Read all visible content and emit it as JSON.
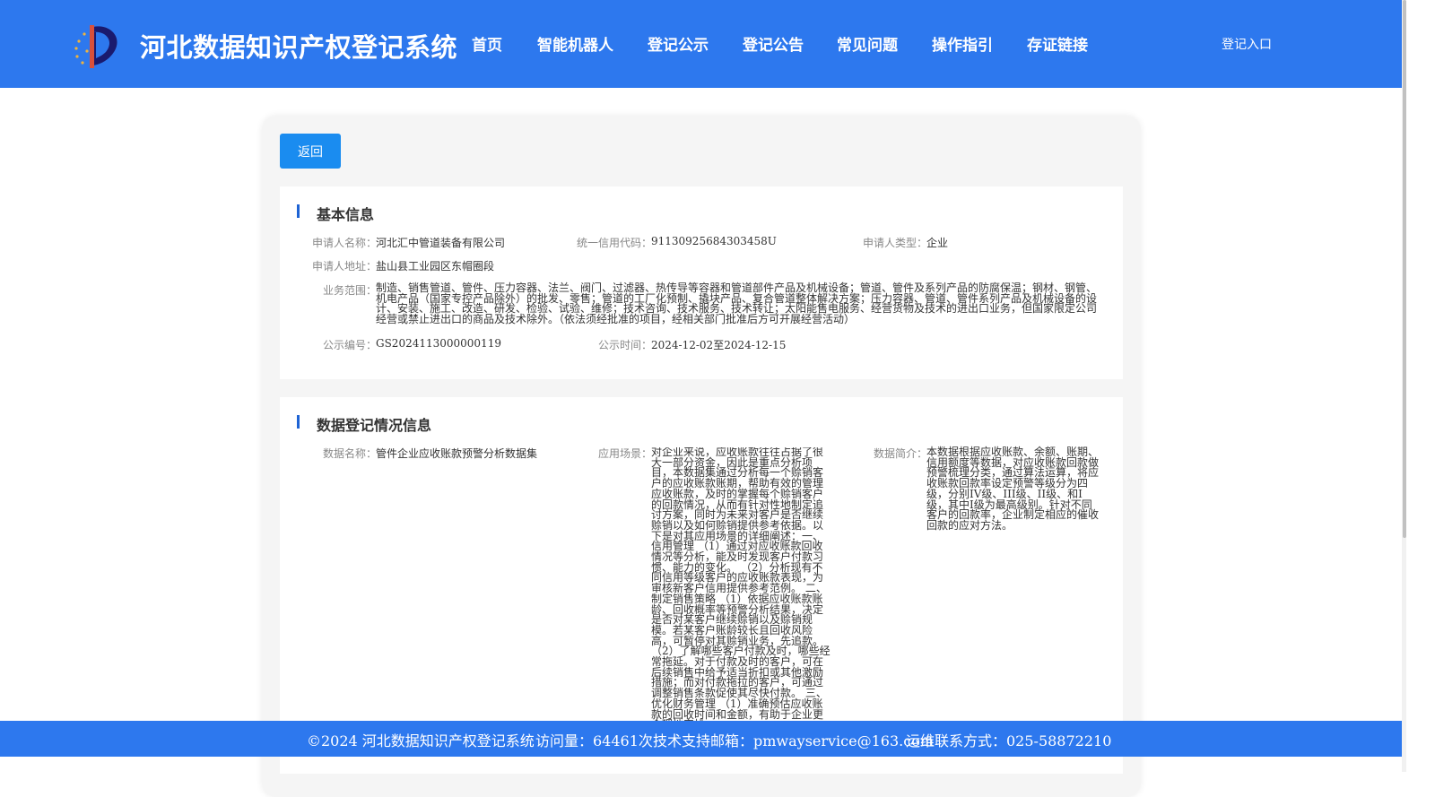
{
  "header": {
    "site_title": "河北数据知识产权登记系统",
    "nav": [
      "首页",
      "智能机器人",
      "登记公示",
      "登记公告",
      "常见问题",
      "操作指引",
      "存证链接"
    ],
    "login": "登记入口"
  },
  "back_button": "返回",
  "basic_info": {
    "title": "基本信息",
    "applicant_name_label": "申请人名称：",
    "applicant_name": "河北汇中管道装备有限公司",
    "credit_code_label": "统一信用代码：",
    "credit_code": "91130925684303458U",
    "applicant_type_label": "申请人类型：",
    "applicant_type": "企业",
    "address_label": "申请人地址：",
    "address": "盐山县工业园区东帽圈段",
    "business_scope_label": "业务范围：",
    "business_scope": "制造、销售管道、管件、压力容器、法兰、阀门、过滤器、热传导等容器和管道部件产品及机械设备；管道、管件及系列产品的防腐保温；钢材、钢管、机电产品（国家专控产品除外）的批发、零售；管道的工厂化预制、撬块产品、复合管道整体解决方案；压力容器、管道、管件系列产品及机械设备的设计、安装、施工、改造、研发、检验、试验、维修；技术咨询、技术服务、技术转让；太阳能售电服务、经营货物及技术的进出口业务，但国家限定公司经营或禁止进出口的商品及技术除外。（依法须经批准的项目，经相关部门批准后方可开展经营活动）",
    "notice_no_label": "公示编号：",
    "notice_no": "GS2024113000000119",
    "notice_time_label": "公示时间：",
    "notice_time": "2024-12-02至2024-12-15"
  },
  "data_info": {
    "title": "数据登记情况信息",
    "data_name_label": "数据名称：",
    "data_name": "管件企业应收账款预警分析数据集",
    "scenario_label": "应用场景：",
    "scenario": "对企业来说，应收账款往往占据了很大一部分资金，因此是重点分析项目，本数据集通过分析每一个赊销客户的应收账款账期，帮助有效的管理应收账款，及时的掌握每个赊销客户的回款情况，从而有针对性地制定追讨方案，同时为未来对客户是否继续赊销以及如何赊销提供参考依据。以下是对其应用场景的详细阐述：一、信用管理 （1）通过对应收账款回收情况等分析，能及时发现客户付款习惯、能力的变化。 （2）分析现有不同信用等级客户的应收账款表现，为审核新客户信用提供参考范例。 二、制定销售策略 （1）依据应收账款账龄、回收概率等预警分析结果，决定是否对某客户继续赊销以及赊销规模。若某客户账龄较长且回收风险高，可暂停对其赊销业务，先追款。 （2）了解哪些客户付款及时，哪些经常拖延。对于付款及时的客户，可在后续销售中给予适当折扣或其他激励措施；而对付款拖拉的客户，可通过调整销售条款促使其尽快付款。 三、优化财务管理 （1）准确预估应收账款的回收时间和金额，有助于企业更合理地安排",
    "intro_label": "数据简介：",
    "intro": "本数据根据应收账款、余额、账期、信用额度等数据，对应收账款回款做预警梳理分类，通过算法运算，将应收账款回款率设定预警等级分为四级，分别IV级、III级、II级、和I级，其中I级为最高级别。针对不同客户的回款率，企业制定相应的催收回款的应对方法。"
  },
  "footer": {
    "copyright": "©2024 河北数据知识产权登记系统",
    "visits": "访问量：64461次",
    "email": "技术支持邮箱：pmwayservice@163.com",
    "phone": "运维联系方式：025-58872210"
  },
  "colors": {
    "header_bg": "#2d78ee",
    "button_bg": "#1a8cf0",
    "section_bar": "#1e63d4"
  }
}
